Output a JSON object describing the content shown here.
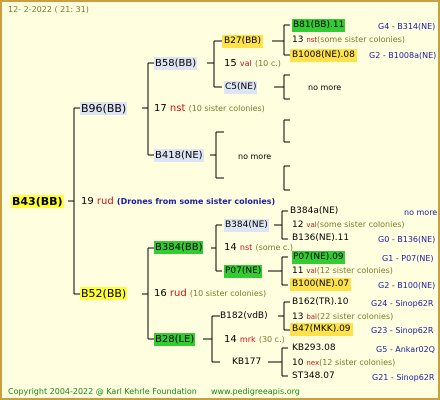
{
  "header": {
    "date": "12-  2-2022 ( 21: 31)"
  },
  "footer": {
    "copyright": "Copyright 2004-2022 @ Karl Kehrle Foundation",
    "site": "www.pedigreeapis.org"
  },
  "root": {
    "name": "B43(BB)",
    "mating_number": "19",
    "mating_code": "rud",
    "mating_note": "(Drones from some sister colonies)"
  },
  "gen1": {
    "dam": {
      "name": "B96(BB)",
      "mating_number": "17",
      "mating_code": "nst",
      "mating_note": "(10 sister colonies)"
    },
    "sire": {
      "name": "B52(BB)",
      "mating_number": "16",
      "mating_code": "rud",
      "mating_note": "(10 sister colonies)"
    }
  },
  "gen2": {
    "b58": {
      "name": "B58(BB)",
      "mating_number": "15",
      "mating_code": "val",
      "mating_note": "(10 c.)"
    },
    "b418": {
      "name": "B418(NE)",
      "note": "no more"
    },
    "b384": {
      "name": "B384(BB)",
      "mating_number": "14",
      "mating_code": "nst",
      "mating_note": "(some c.)"
    },
    "b28": {
      "name": "B28(LE)",
      "mating_number": "14",
      "mating_code": "mrk",
      "mating_note": "(30 c.)"
    }
  },
  "gen3": {
    "b27": {
      "name": "B27(BB)",
      "mating_number": "13",
      "mating_code": "nst",
      "mating_note": "(some sister colonies)"
    },
    "c5": {
      "name": "C5(NE)",
      "note": "no more"
    },
    "b418_note": "no more",
    "b384ne": {
      "name": "B384(NE)",
      "mating_number": "12",
      "mating_code": "val",
      "mating_note": "(some sister colonies)"
    },
    "p07": {
      "name": "P07(NE)",
      "mating_number": "11",
      "mating_code": "val",
      "mating_note": "(12 sister colonies)"
    },
    "b182": {
      "name": "B182(vdB)",
      "mating_number": "13",
      "mating_code": "bal",
      "mating_note": "(22 sister colonies)"
    },
    "kb177": {
      "name": "KB177",
      "mating_number": "10",
      "mating_code": "nex",
      "mating_note": "(12 sister colonies)"
    }
  },
  "gen4": [
    {
      "name": "B81(BB).11",
      "ref": "G4 - B314(NE)",
      "style": "green"
    },
    {
      "name": "B1008(NE).08",
      "ref": "G2 - B1008a(NE)",
      "style": "yellow"
    },
    {
      "name": "B384a(NE)",
      "ref": "no more",
      "style": "none"
    },
    {
      "name": "B136(NE).11",
      "ref": "G0 - B136(NE)",
      "style": "none"
    },
    {
      "name": "P07(NE).09",
      "ref": "G1 - P07(NE)",
      "style": "green"
    },
    {
      "name": "B100(NE).07",
      "ref": "G2 - B100(NE)",
      "style": "yellow"
    },
    {
      "name": "B162(TR).10",
      "ref": "G24 - Sinop62R",
      "style": "none"
    },
    {
      "name": "B47(MKK).09",
      "ref": "G23 - Sinop62R",
      "style": "yellow"
    },
    {
      "name": "KB293.08",
      "ref": "G5 - Ankar02Q",
      "style": "none"
    },
    {
      "name": "ST348.07",
      "ref": "G21 - Sinop62R",
      "style": "none"
    }
  ],
  "c5_right_note": "no more"
}
